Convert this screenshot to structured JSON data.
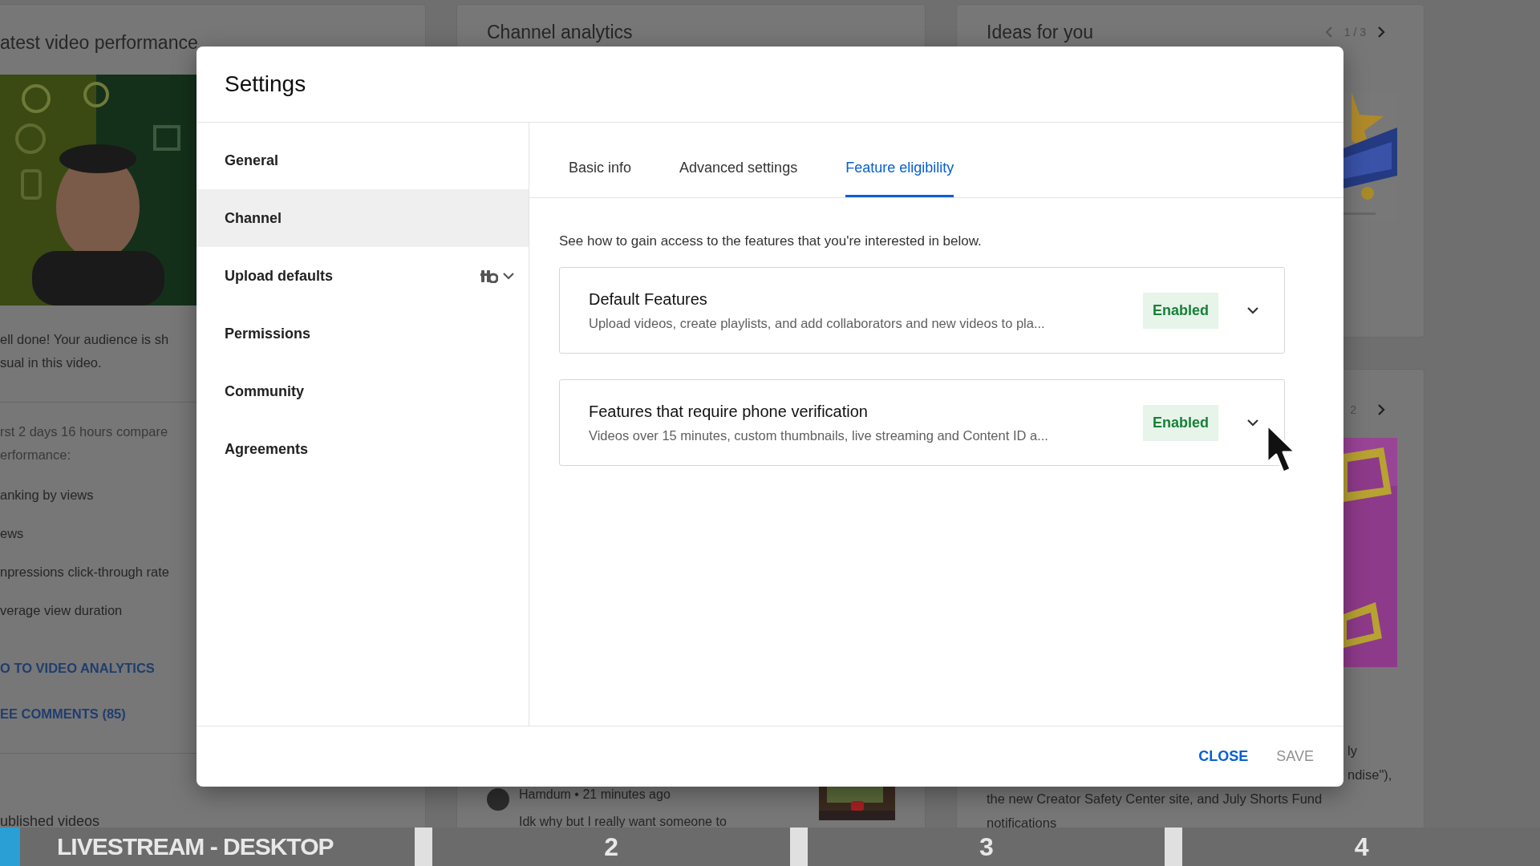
{
  "background": {
    "left_card": {
      "title": "atest video performance",
      "summary": [
        "ell done! Your audience is sh",
        "sual in this video."
      ],
      "comparison": [
        "rst 2 days 16 hours compare",
        "erformance:"
      ],
      "metrics": [
        "anking by views",
        "ews",
        "npressions click-through rate",
        "verage view duration"
      ],
      "links": [
        "O TO VIDEO ANALYTICS",
        "EE COMMENTS (85)"
      ],
      "footer_title": "ublished videos"
    },
    "middle_card": {
      "title": "Channel analytics",
      "comment": {
        "author": "Hamdum • 21 minutes ago",
        "text": "Idk why but I really want someone to"
      }
    },
    "right_cards": [
      {
        "title": "Ideas for you",
        "pager": "1 / 3"
      },
      {
        "pager": "2",
        "lines": [
          "ly",
          "ndise\"),"
        ],
        "paragraph": [
          "the new Creator Safety Center site, and July Shorts Fund",
          "notifications"
        ]
      }
    ]
  },
  "dialog": {
    "title": "Settings",
    "sidebar": [
      {
        "label": "General",
        "selected": false,
        "kind": "plain"
      },
      {
        "label": "Channel",
        "selected": true,
        "kind": "plain"
      },
      {
        "label": "Upload defaults",
        "selected": false,
        "kind": "extension"
      },
      {
        "label": "Permissions",
        "selected": false,
        "kind": "plain"
      },
      {
        "label": "Community",
        "selected": false,
        "kind": "plain"
      },
      {
        "label": "Agreements",
        "selected": false,
        "kind": "plain"
      }
    ],
    "tabs": [
      {
        "label": "Basic info",
        "selected": false
      },
      {
        "label": "Advanced settings",
        "selected": false
      },
      {
        "label": "Feature eligibility",
        "selected": true
      }
    ],
    "intro": "See how to gain access to the features that you're interested in below.",
    "features": [
      {
        "title": "Default Features",
        "description": "Upload videos, create playlists, and add collaborators and new videos to pla...",
        "status": "Enabled",
        "expanded": false
      },
      {
        "title": "Features that require phone verification",
        "description": "Videos over 15 minutes, custom thumbnails, live streaming and Content ID a...",
        "status": "Enabled",
        "expanded": false
      }
    ],
    "buttons": [
      {
        "label": "CLOSE",
        "disabled": false
      },
      {
        "label": "SAVE",
        "disabled": true
      }
    ]
  },
  "chapter_bar": {
    "level": 0.013,
    "chapters": [
      "LIVESTREAM - DESKTOP",
      "2",
      "3",
      "4"
    ]
  }
}
